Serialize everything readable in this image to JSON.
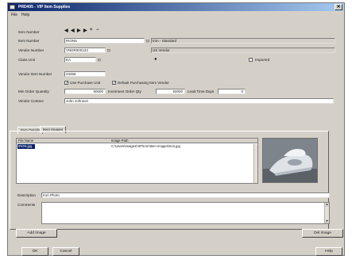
{
  "window": {
    "title": "PRD405 - VIP Item Supplies",
    "close": "✕"
  },
  "menu": {
    "file": "File",
    "help": "Help"
  },
  "form": {
    "item_number_label": "Item Number",
    "item_number_value": "IRON5",
    "item_description": "Iron - Standard",
    "vendor_number_label": "Vendor Number",
    "vendor_number_value": "VNDR000123",
    "vendor_name": "US Vendor",
    "class_unit_label": "Class Unit",
    "class_unit_value": "EA",
    "imported_label": "Imported",
    "vendor_item_number_label": "Vendor Item Number",
    "vendor_item_number_value": "23456",
    "use_purchase_unit_label": "Use Purchase Unit",
    "default_purchasing_label": "Default Purchasing Item Vendor",
    "min_order_qty_label": "Min Order Quantity",
    "min_order_qty_value": "50000",
    "increment_qty_label": "Increment Order Qty",
    "increment_qty_value": "50000",
    "lead_time_label": "Lead Time Days",
    "lead_time_value": "0",
    "vendor_contact_label": "Vendor Contact",
    "vendor_contact_value": "John Johnson"
  },
  "nav_glyphs": [
    "◀",
    "◀",
    "▶",
    "▶",
    "+",
    "−"
  ],
  "tabs": [
    "Item Details",
    "Item Images"
  ],
  "grid": {
    "columns": [
      "File Name",
      "Image Path"
    ],
    "rows": [
      {
        "file": "IRON.jpg",
        "path": "C:\\Users\\Images\\VIP\\Iron\\Item Images\\Iron.jpg"
      }
    ]
  },
  "detail": {
    "description_label": "Description",
    "description_value": "Iron Photo",
    "comments_label": "Comments",
    "comments_value": ""
  },
  "buttons": {
    "add_image": "Add Image",
    "delete_image": "Del Image",
    "ok": "OK",
    "cancel": "Cancel",
    "help": "Help"
  },
  "colors": {
    "titlebar": "#0a246a",
    "selection": "#0a246a",
    "window_bg": "#d4d0c8"
  },
  "checks": {
    "mark": "✓"
  },
  "icons": {
    "title": "window-icon",
    "help_dot": "help-dot-icon"
  }
}
